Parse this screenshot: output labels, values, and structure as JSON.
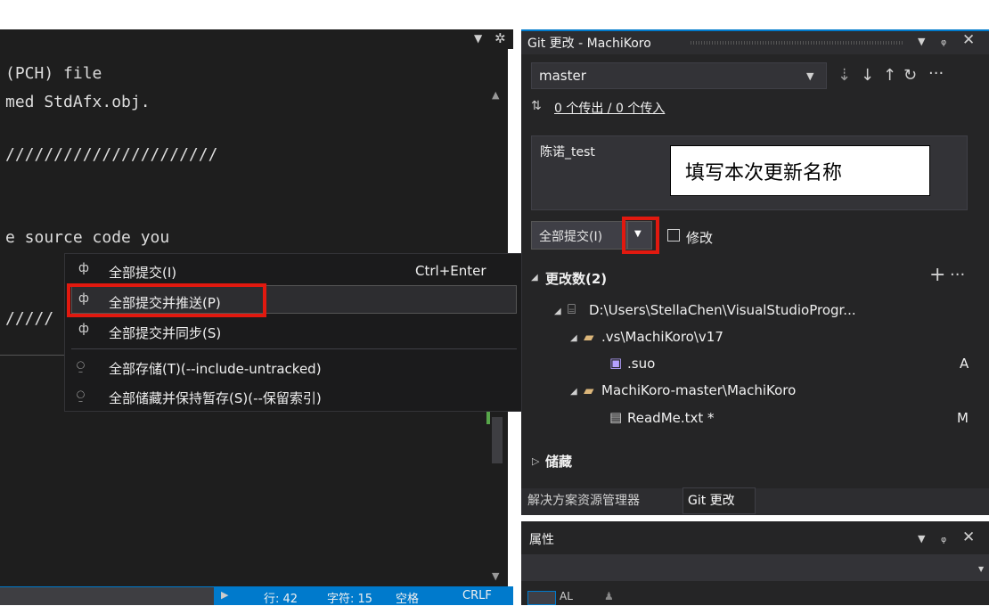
{
  "editor": {
    "lines": [
      "(PCH) file",
      "med StdAfx.obj.",
      "//////////////////////",
      "e source code you",
      "/////"
    ],
    "pin_symbol": "÷"
  },
  "status_bar": {
    "line": "行: 42",
    "char": "字符: 15",
    "space": "空格",
    "eol": "CRLF"
  },
  "git_panel": {
    "title": "Git 更改 - MachiKoro",
    "branch": "master",
    "sync_text": "0 个传出 / 0 个传入",
    "message": "陈诺_test",
    "commit_label": "全部提交(I)",
    "amend_label": "修改",
    "changes_header": "更改数(2)",
    "tree": [
      {
        "label": "D:\\Users\\StellaChen\\VisualStudioProgr...",
        "status": ""
      },
      {
        "label": ".vs\\MachiKoro\\v17",
        "status": ""
      },
      {
        "label": ".suo",
        "status": "A"
      },
      {
        "label": "MachiKoro-master\\MachiKoro",
        "status": ""
      },
      {
        "label": "ReadMe.txt *",
        "status": "M"
      }
    ],
    "stash_header": "储藏"
  },
  "tabs": {
    "solution_explorer": "解决方案资源管理器",
    "git_changes": "Git 更改"
  },
  "properties": {
    "title": "属性"
  },
  "callout": {
    "text": "填写本次更新名称"
  },
  "menu": {
    "items": [
      {
        "label": "全部提交(I)",
        "shortcut": "Ctrl+Enter"
      },
      {
        "label": "全部提交并推送(P)",
        "shortcut": ""
      },
      {
        "label": "全部提交并同步(S)",
        "shortcut": ""
      },
      {
        "label": "全部存储(T)(--include-untracked)",
        "shortcut": ""
      },
      {
        "label": "全部储藏并保持暂存(S)(--保留索引)",
        "shortcut": ""
      }
    ]
  },
  "colors": {
    "accent": "#007acc",
    "highlight_red": "#e1190f"
  }
}
